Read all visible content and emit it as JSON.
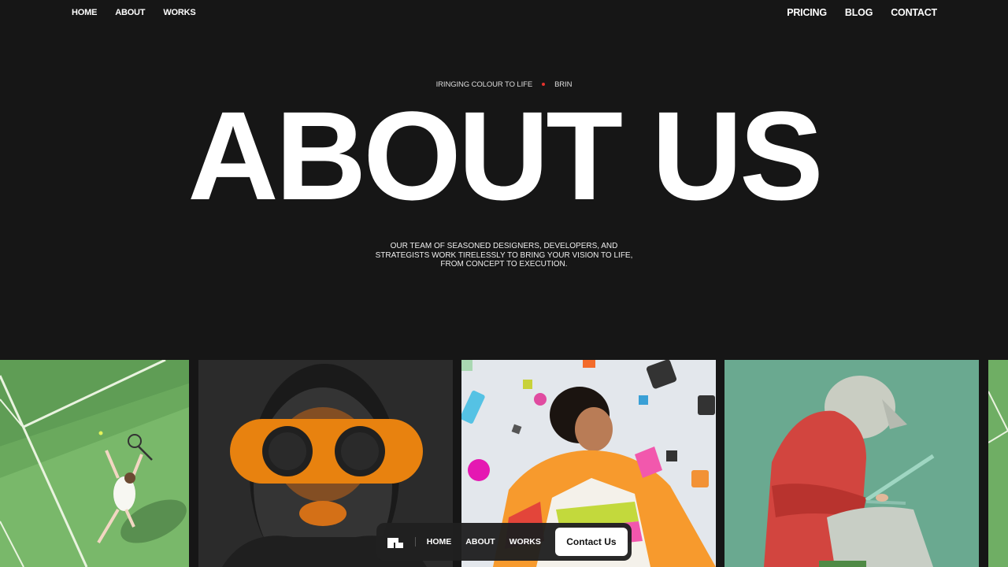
{
  "nav": {
    "left": [
      "HOME",
      "ABOUT",
      "WORKS"
    ],
    "right": [
      "PRICING",
      "BLOG",
      "CONTACT"
    ]
  },
  "marquee": {
    "text_1": "IRINGING COLOUR TO LIFE",
    "text_2": "BRIN",
    "dot_color": "#e5322d"
  },
  "hero": {
    "title": "ABOUT US"
  },
  "intro": {
    "line_1": "OUR TEAM OF SEASONED DESIGNERS, DEVELOPERS, AND",
    "line_2": "STRATEGISTS WORK TIRELESSLY TO BRING YOUR VISION TO LIFE,",
    "line_3": "FROM CONCEPT TO EXECUTION."
  },
  "gallery": {
    "cards": [
      {
        "name": "tennis-player-image",
        "bg": "#76b469"
      },
      {
        "name": "orange-goggles-portrait-image",
        "bg": "#2b2b2b"
      },
      {
        "name": "colorful-jacket-portrait-image",
        "bg": "#dfe4ea"
      },
      {
        "name": "hoodie-laptop-image",
        "bg": "#6aa890"
      }
    ]
  },
  "dock": {
    "logo_icon": "studio-logo-icon",
    "links": [
      "HOME",
      "ABOUT",
      "WORKS"
    ],
    "cta": "Contact Us"
  },
  "colors": {
    "background": "#161616",
    "text": "#ffffff",
    "accent": "#e5322d"
  }
}
